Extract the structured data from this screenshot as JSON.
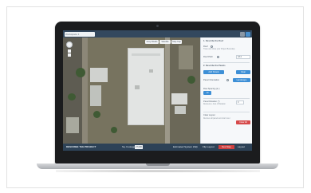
{
  "toolbar": {
    "address_value": "Workspace 1"
  },
  "map": {
    "tabs": [
      "Grey Roads",
      "Satellite",
      "Map Cap"
    ],
    "imagery": "satellite"
  },
  "panel": {
    "section1_title": "1. Describe the Roof",
    "roof_label": "Roof",
    "roof_hint": "Trace and close your Project Boundary",
    "roof_pitch_label": "Roof Pitch",
    "roof_pitch_value": "4/12",
    "section2_title": "2. Describe the Panels",
    "add_panels_button": "Add Panels",
    "clear_button": "Clear",
    "panel_orientation_label": "Panel Orientation",
    "orientation_button": "Landscape",
    "row_spacing_label": "Row Spacing (in.)",
    "row_spacing_value": "10",
    "panel_rotation_label": "Panel Rotation (°)",
    "panel_rotation_value": "0",
    "panel_rotation_hint": "Reference: Axis of Rotation",
    "clear_layout_title": "Clear Layout",
    "clear_layout_hint": "Remove all panels and start over",
    "clear_all_button": "Clear All"
  },
  "bottombar": {
    "title": "DESCRIBE THE PROJECT",
    "size_label": "Sq. Footage",
    "size_value": "27,000",
    "estimate_label": "Estimated System kWp",
    "flip_label": "Flip Layout",
    "layout_label": "Layout",
    "red_button": "Next Step"
  },
  "colors": {
    "accent": "#3d8fd6",
    "header": "#33485e",
    "danger": "#d64a4a"
  }
}
